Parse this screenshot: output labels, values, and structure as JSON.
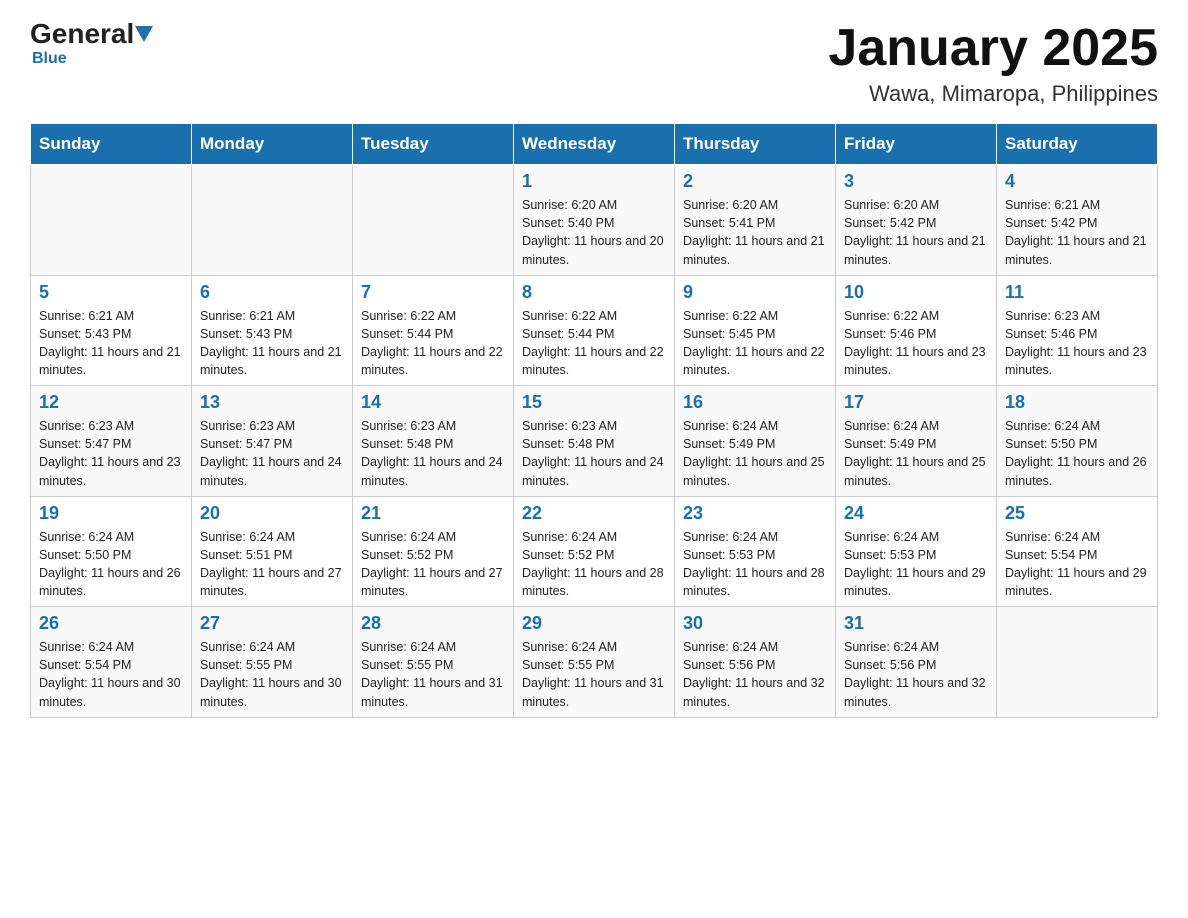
{
  "logo": {
    "name_black": "General",
    "name_blue": "Blue",
    "sub": "Blue"
  },
  "title": "January 2025",
  "subtitle": "Wawa, Mimaropa, Philippines",
  "days": [
    "Sunday",
    "Monday",
    "Tuesday",
    "Wednesday",
    "Thursday",
    "Friday",
    "Saturday"
  ],
  "weeks": [
    [
      {
        "day": "",
        "info": ""
      },
      {
        "day": "",
        "info": ""
      },
      {
        "day": "",
        "info": ""
      },
      {
        "day": "1",
        "info": "Sunrise: 6:20 AM\nSunset: 5:40 PM\nDaylight: 11 hours and 20 minutes."
      },
      {
        "day": "2",
        "info": "Sunrise: 6:20 AM\nSunset: 5:41 PM\nDaylight: 11 hours and 21 minutes."
      },
      {
        "day": "3",
        "info": "Sunrise: 6:20 AM\nSunset: 5:42 PM\nDaylight: 11 hours and 21 minutes."
      },
      {
        "day": "4",
        "info": "Sunrise: 6:21 AM\nSunset: 5:42 PM\nDaylight: 11 hours and 21 minutes."
      }
    ],
    [
      {
        "day": "5",
        "info": "Sunrise: 6:21 AM\nSunset: 5:43 PM\nDaylight: 11 hours and 21 minutes."
      },
      {
        "day": "6",
        "info": "Sunrise: 6:21 AM\nSunset: 5:43 PM\nDaylight: 11 hours and 21 minutes."
      },
      {
        "day": "7",
        "info": "Sunrise: 6:22 AM\nSunset: 5:44 PM\nDaylight: 11 hours and 22 minutes."
      },
      {
        "day": "8",
        "info": "Sunrise: 6:22 AM\nSunset: 5:44 PM\nDaylight: 11 hours and 22 minutes."
      },
      {
        "day": "9",
        "info": "Sunrise: 6:22 AM\nSunset: 5:45 PM\nDaylight: 11 hours and 22 minutes."
      },
      {
        "day": "10",
        "info": "Sunrise: 6:22 AM\nSunset: 5:46 PM\nDaylight: 11 hours and 23 minutes."
      },
      {
        "day": "11",
        "info": "Sunrise: 6:23 AM\nSunset: 5:46 PM\nDaylight: 11 hours and 23 minutes."
      }
    ],
    [
      {
        "day": "12",
        "info": "Sunrise: 6:23 AM\nSunset: 5:47 PM\nDaylight: 11 hours and 23 minutes."
      },
      {
        "day": "13",
        "info": "Sunrise: 6:23 AM\nSunset: 5:47 PM\nDaylight: 11 hours and 24 minutes."
      },
      {
        "day": "14",
        "info": "Sunrise: 6:23 AM\nSunset: 5:48 PM\nDaylight: 11 hours and 24 minutes."
      },
      {
        "day": "15",
        "info": "Sunrise: 6:23 AM\nSunset: 5:48 PM\nDaylight: 11 hours and 24 minutes."
      },
      {
        "day": "16",
        "info": "Sunrise: 6:24 AM\nSunset: 5:49 PM\nDaylight: 11 hours and 25 minutes."
      },
      {
        "day": "17",
        "info": "Sunrise: 6:24 AM\nSunset: 5:49 PM\nDaylight: 11 hours and 25 minutes."
      },
      {
        "day": "18",
        "info": "Sunrise: 6:24 AM\nSunset: 5:50 PM\nDaylight: 11 hours and 26 minutes."
      }
    ],
    [
      {
        "day": "19",
        "info": "Sunrise: 6:24 AM\nSunset: 5:50 PM\nDaylight: 11 hours and 26 minutes."
      },
      {
        "day": "20",
        "info": "Sunrise: 6:24 AM\nSunset: 5:51 PM\nDaylight: 11 hours and 27 minutes."
      },
      {
        "day": "21",
        "info": "Sunrise: 6:24 AM\nSunset: 5:52 PM\nDaylight: 11 hours and 27 minutes."
      },
      {
        "day": "22",
        "info": "Sunrise: 6:24 AM\nSunset: 5:52 PM\nDaylight: 11 hours and 28 minutes."
      },
      {
        "day": "23",
        "info": "Sunrise: 6:24 AM\nSunset: 5:53 PM\nDaylight: 11 hours and 28 minutes."
      },
      {
        "day": "24",
        "info": "Sunrise: 6:24 AM\nSunset: 5:53 PM\nDaylight: 11 hours and 29 minutes."
      },
      {
        "day": "25",
        "info": "Sunrise: 6:24 AM\nSunset: 5:54 PM\nDaylight: 11 hours and 29 minutes."
      }
    ],
    [
      {
        "day": "26",
        "info": "Sunrise: 6:24 AM\nSunset: 5:54 PM\nDaylight: 11 hours and 30 minutes."
      },
      {
        "day": "27",
        "info": "Sunrise: 6:24 AM\nSunset: 5:55 PM\nDaylight: 11 hours and 30 minutes."
      },
      {
        "day": "28",
        "info": "Sunrise: 6:24 AM\nSunset: 5:55 PM\nDaylight: 11 hours and 31 minutes."
      },
      {
        "day": "29",
        "info": "Sunrise: 6:24 AM\nSunset: 5:55 PM\nDaylight: 11 hours and 31 minutes."
      },
      {
        "day": "30",
        "info": "Sunrise: 6:24 AM\nSunset: 5:56 PM\nDaylight: 11 hours and 32 minutes."
      },
      {
        "day": "31",
        "info": "Sunrise: 6:24 AM\nSunset: 5:56 PM\nDaylight: 11 hours and 32 minutes."
      },
      {
        "day": "",
        "info": ""
      }
    ]
  ]
}
